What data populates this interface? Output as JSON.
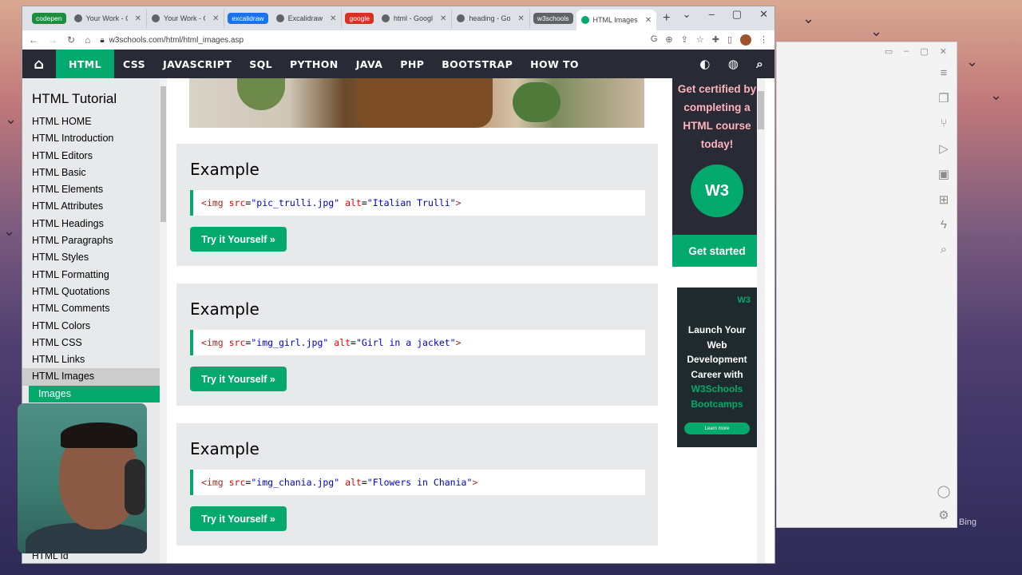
{
  "tabs": [
    {
      "type": "group",
      "label": "codepen",
      "color": "#1e8e3e"
    },
    {
      "type": "tab",
      "label": "Your Work - C"
    },
    {
      "type": "tab",
      "label": "Your Work - C"
    },
    {
      "type": "group",
      "label": "excalidraw",
      "color": "#1a73e8"
    },
    {
      "type": "tab",
      "label": "Excalidraw"
    },
    {
      "type": "group",
      "label": "google",
      "color": "#d93025"
    },
    {
      "type": "tab",
      "label": "html - Googl"
    },
    {
      "type": "tab",
      "label": "heading - Go"
    },
    {
      "type": "group",
      "label": "w3schools",
      "color": "#5f6368"
    },
    {
      "type": "active",
      "label": "HTML Images"
    }
  ],
  "address": {
    "url": "w3schools.com/html/html_images.asp"
  },
  "nav": {
    "items": [
      "HTML",
      "CSS",
      "JAVASCRIPT",
      "SQL",
      "PYTHON",
      "JAVA",
      "PHP",
      "BOOTSTRAP",
      "HOW TO"
    ],
    "active": "HTML"
  },
  "sidebar": {
    "title": "HTML Tutorial",
    "links": [
      "HTML HOME",
      "HTML Introduction",
      "HTML Editors",
      "HTML Basic",
      "HTML Elements",
      "HTML Attributes",
      "HTML Headings",
      "HTML Paragraphs",
      "HTML Styles",
      "HTML Formatting",
      "HTML Quotations",
      "HTML Comments",
      "HTML Colors",
      "HTML CSS",
      "HTML Links",
      "HTML Images"
    ],
    "selected": "HTML Images",
    "sub_link": "Images",
    "bottom_link": "HTML Id"
  },
  "examples": [
    {
      "heading": "Example",
      "src": "pic_trulli.jpg",
      "alt": "Italian Trulli",
      "button": "Try it Yourself »"
    },
    {
      "heading": "Example",
      "src": "img_girl.jpg",
      "alt": "Girl in a jacket",
      "button": "Try it Yourself »"
    },
    {
      "heading": "Example",
      "src": "img_chania.jpg",
      "alt": "Flowers in Chania",
      "button": "Try it Yourself »"
    }
  ],
  "cert_ad": {
    "text": "Get certified by completing a HTML course today!",
    "badge": "W3",
    "button": "Get started"
  },
  "bootcamp_ad": {
    "logo": "W3",
    "text_plain": "Launch Your Web Development Career with",
    "text_highlight": "W3Schools Bootcamps",
    "button": "Learn more"
  },
  "background_text": "Bing",
  "colors": {
    "accent": "#04aa6d",
    "nav_bg": "#282a35",
    "sidebar_bg": "#e7e9eb"
  }
}
